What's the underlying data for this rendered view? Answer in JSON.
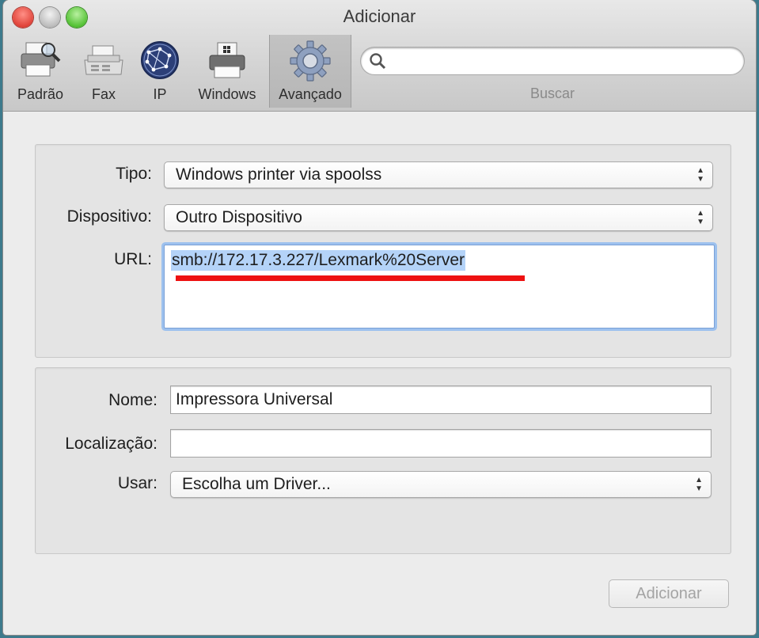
{
  "window": {
    "title": "Adicionar"
  },
  "toolbar": {
    "items": [
      {
        "label": "Padrão",
        "icon": "printer-search-icon"
      },
      {
        "label": "Fax",
        "icon": "fax-icon"
      },
      {
        "label": "IP",
        "icon": "globe-icon"
      },
      {
        "label": "Windows",
        "icon": "windows-printer-icon"
      },
      {
        "label": "Avançado",
        "icon": "gear-icon",
        "selected": true
      }
    ],
    "search": {
      "value": "",
      "placeholder": "",
      "label": "Buscar"
    }
  },
  "connection": {
    "tipo_label": "Tipo:",
    "tipo_value": "Windows printer via spoolss",
    "dispositivo_label": "Dispositivo:",
    "dispositivo_value": "Outro Dispositivo",
    "url_label": "URL:",
    "url_value": "smb://172.17.3.227/Lexmark%20Server"
  },
  "details": {
    "nome_label": "Nome:",
    "nome_value": "Impressora Universal",
    "localizacao_label": "Localização:",
    "localizacao_value": "",
    "usar_label": "Usar:",
    "usar_value": "Escolha um Driver..."
  },
  "footer": {
    "add_label": "Adicionar"
  },
  "colors": {
    "highlight": "#b4d3f8",
    "annotation_red": "#ee1111",
    "focus_ring": "#9dc1ee"
  }
}
